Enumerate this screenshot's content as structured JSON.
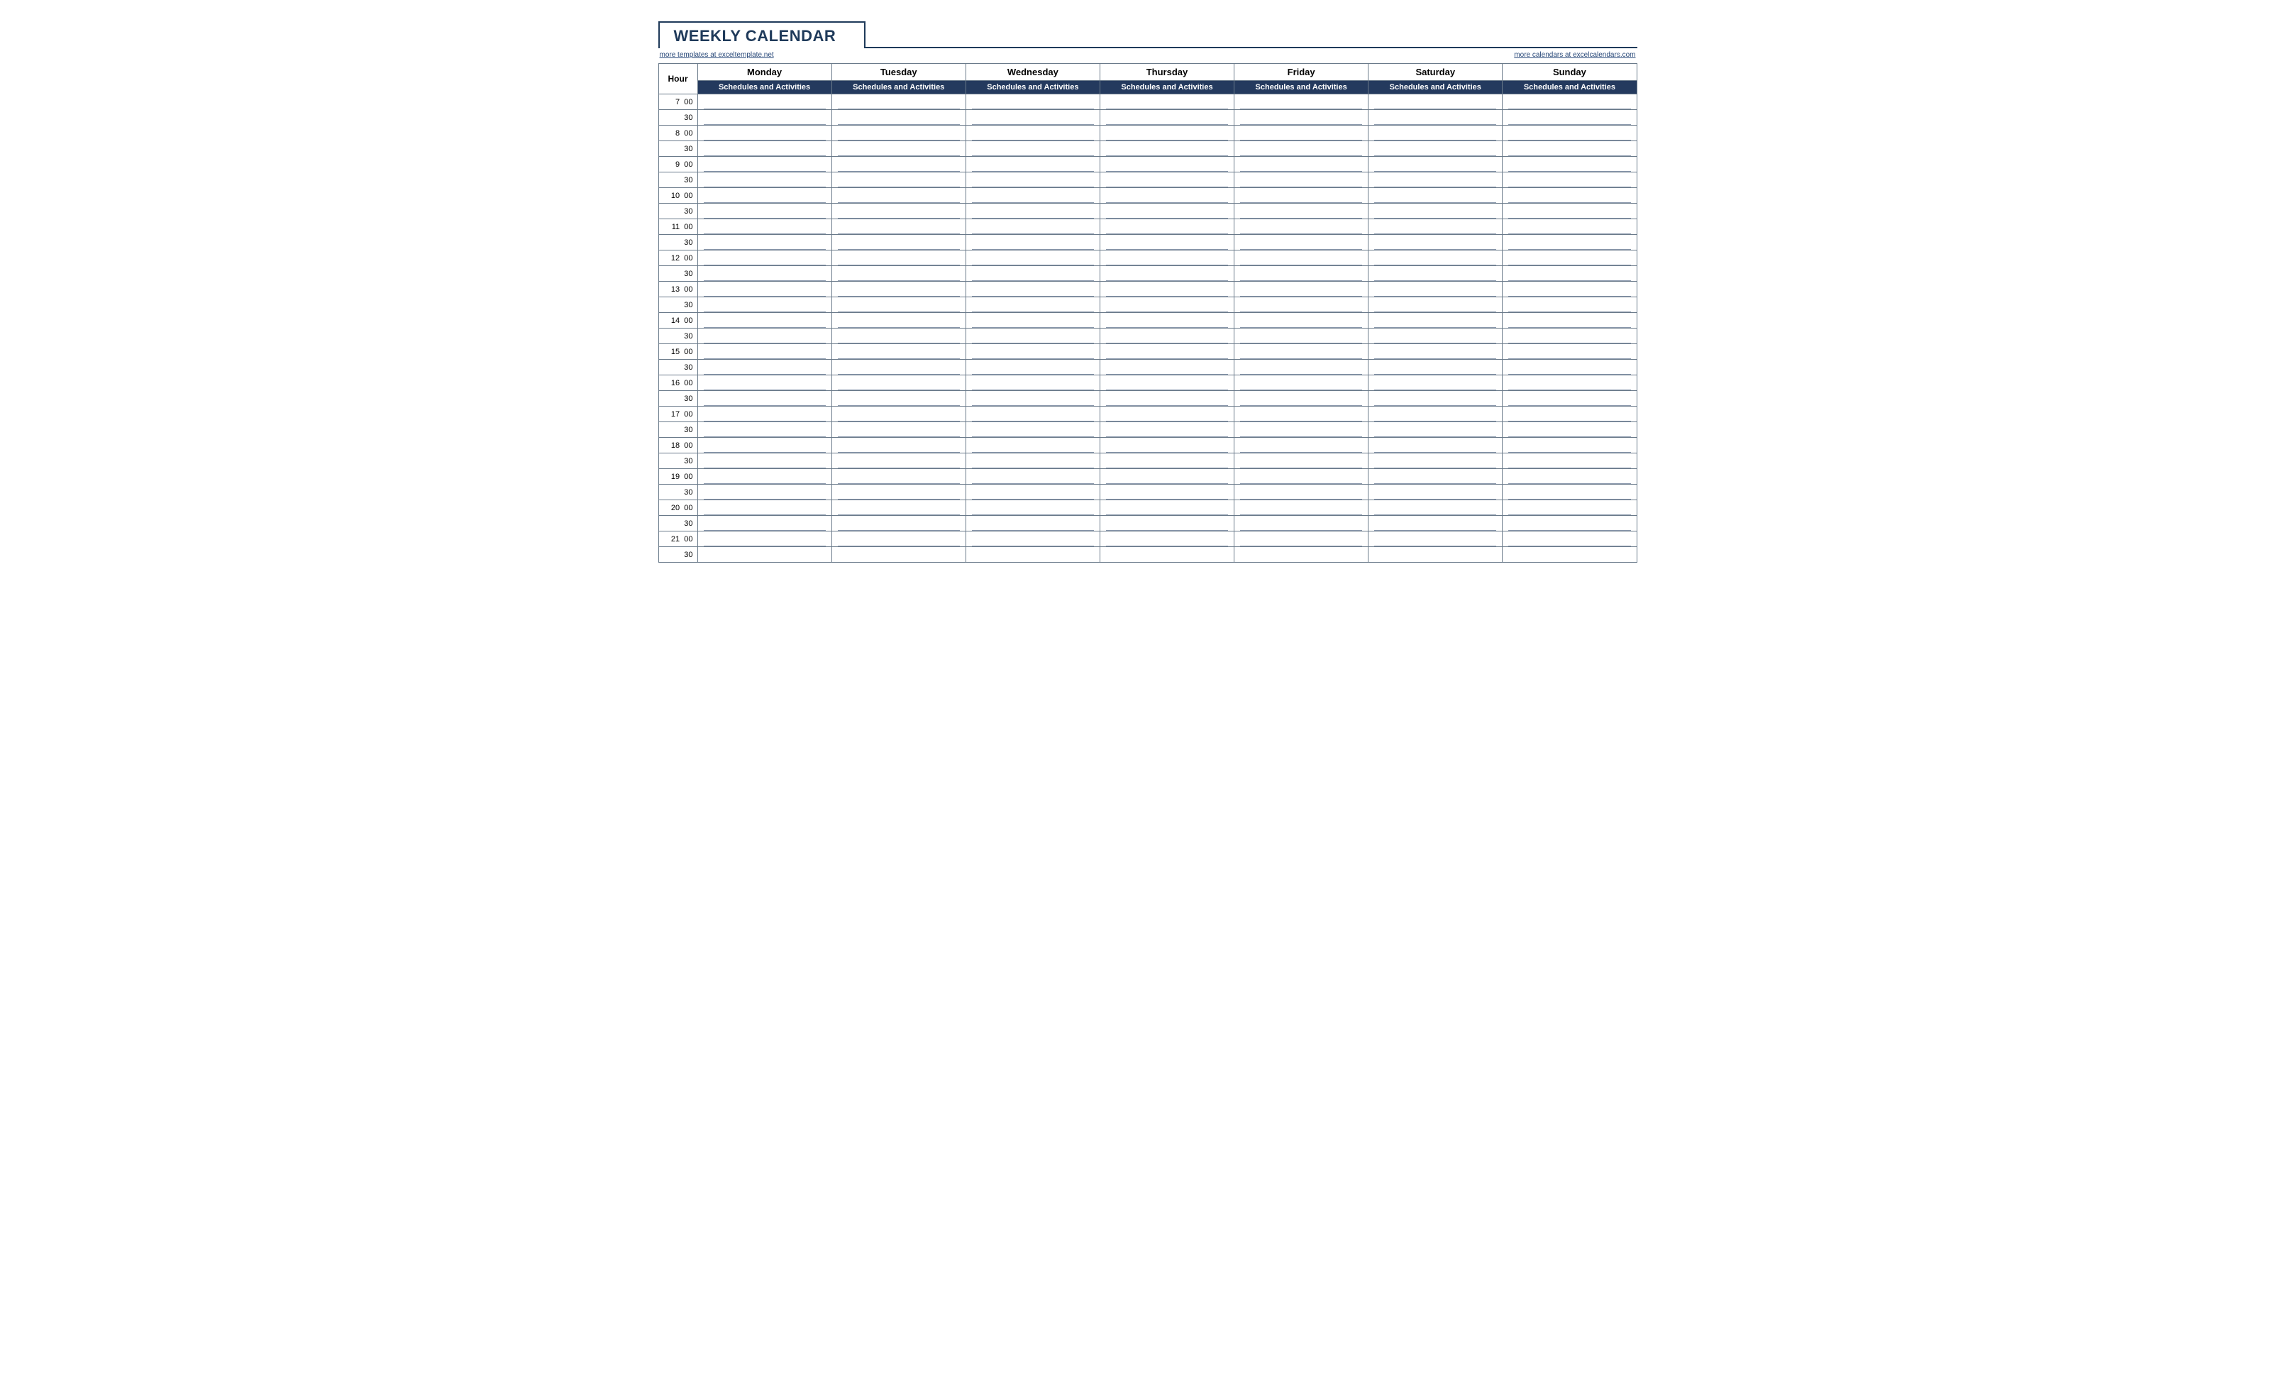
{
  "title": "WEEKLY CALENDAR",
  "links": {
    "left": "more templates at exceltemplate.net",
    "right": "more calendars at excelcalendars.com"
  },
  "header": {
    "hour_label": "Hour",
    "days": [
      "Monday",
      "Tuesday",
      "Wednesday",
      "Thursday",
      "Friday",
      "Saturday",
      "Sunday"
    ],
    "sub_label": "Schedules and Activities"
  },
  "time_slots": [
    {
      "h": "7",
      "m": "00"
    },
    {
      "h": "",
      "m": "30"
    },
    {
      "h": "8",
      "m": "00"
    },
    {
      "h": "",
      "m": "30"
    },
    {
      "h": "9",
      "m": "00"
    },
    {
      "h": "",
      "m": "30"
    },
    {
      "h": "10",
      "m": "00"
    },
    {
      "h": "",
      "m": "30"
    },
    {
      "h": "11",
      "m": "00"
    },
    {
      "h": "",
      "m": "30"
    },
    {
      "h": "12",
      "m": "00"
    },
    {
      "h": "",
      "m": "30"
    },
    {
      "h": "13",
      "m": "00"
    },
    {
      "h": "",
      "m": "30"
    },
    {
      "h": "14",
      "m": "00"
    },
    {
      "h": "",
      "m": "30"
    },
    {
      "h": "15",
      "m": "00"
    },
    {
      "h": "",
      "m": "30"
    },
    {
      "h": "16",
      "m": "00"
    },
    {
      "h": "",
      "m": "30"
    },
    {
      "h": "17",
      "m": "00"
    },
    {
      "h": "",
      "m": "30"
    },
    {
      "h": "18",
      "m": "00"
    },
    {
      "h": "",
      "m": "30"
    },
    {
      "h": "19",
      "m": "00"
    },
    {
      "h": "",
      "m": "30"
    },
    {
      "h": "20",
      "m": "00"
    },
    {
      "h": "",
      "m": "30"
    },
    {
      "h": "21",
      "m": "00"
    },
    {
      "h": "",
      "m": "30"
    }
  ]
}
